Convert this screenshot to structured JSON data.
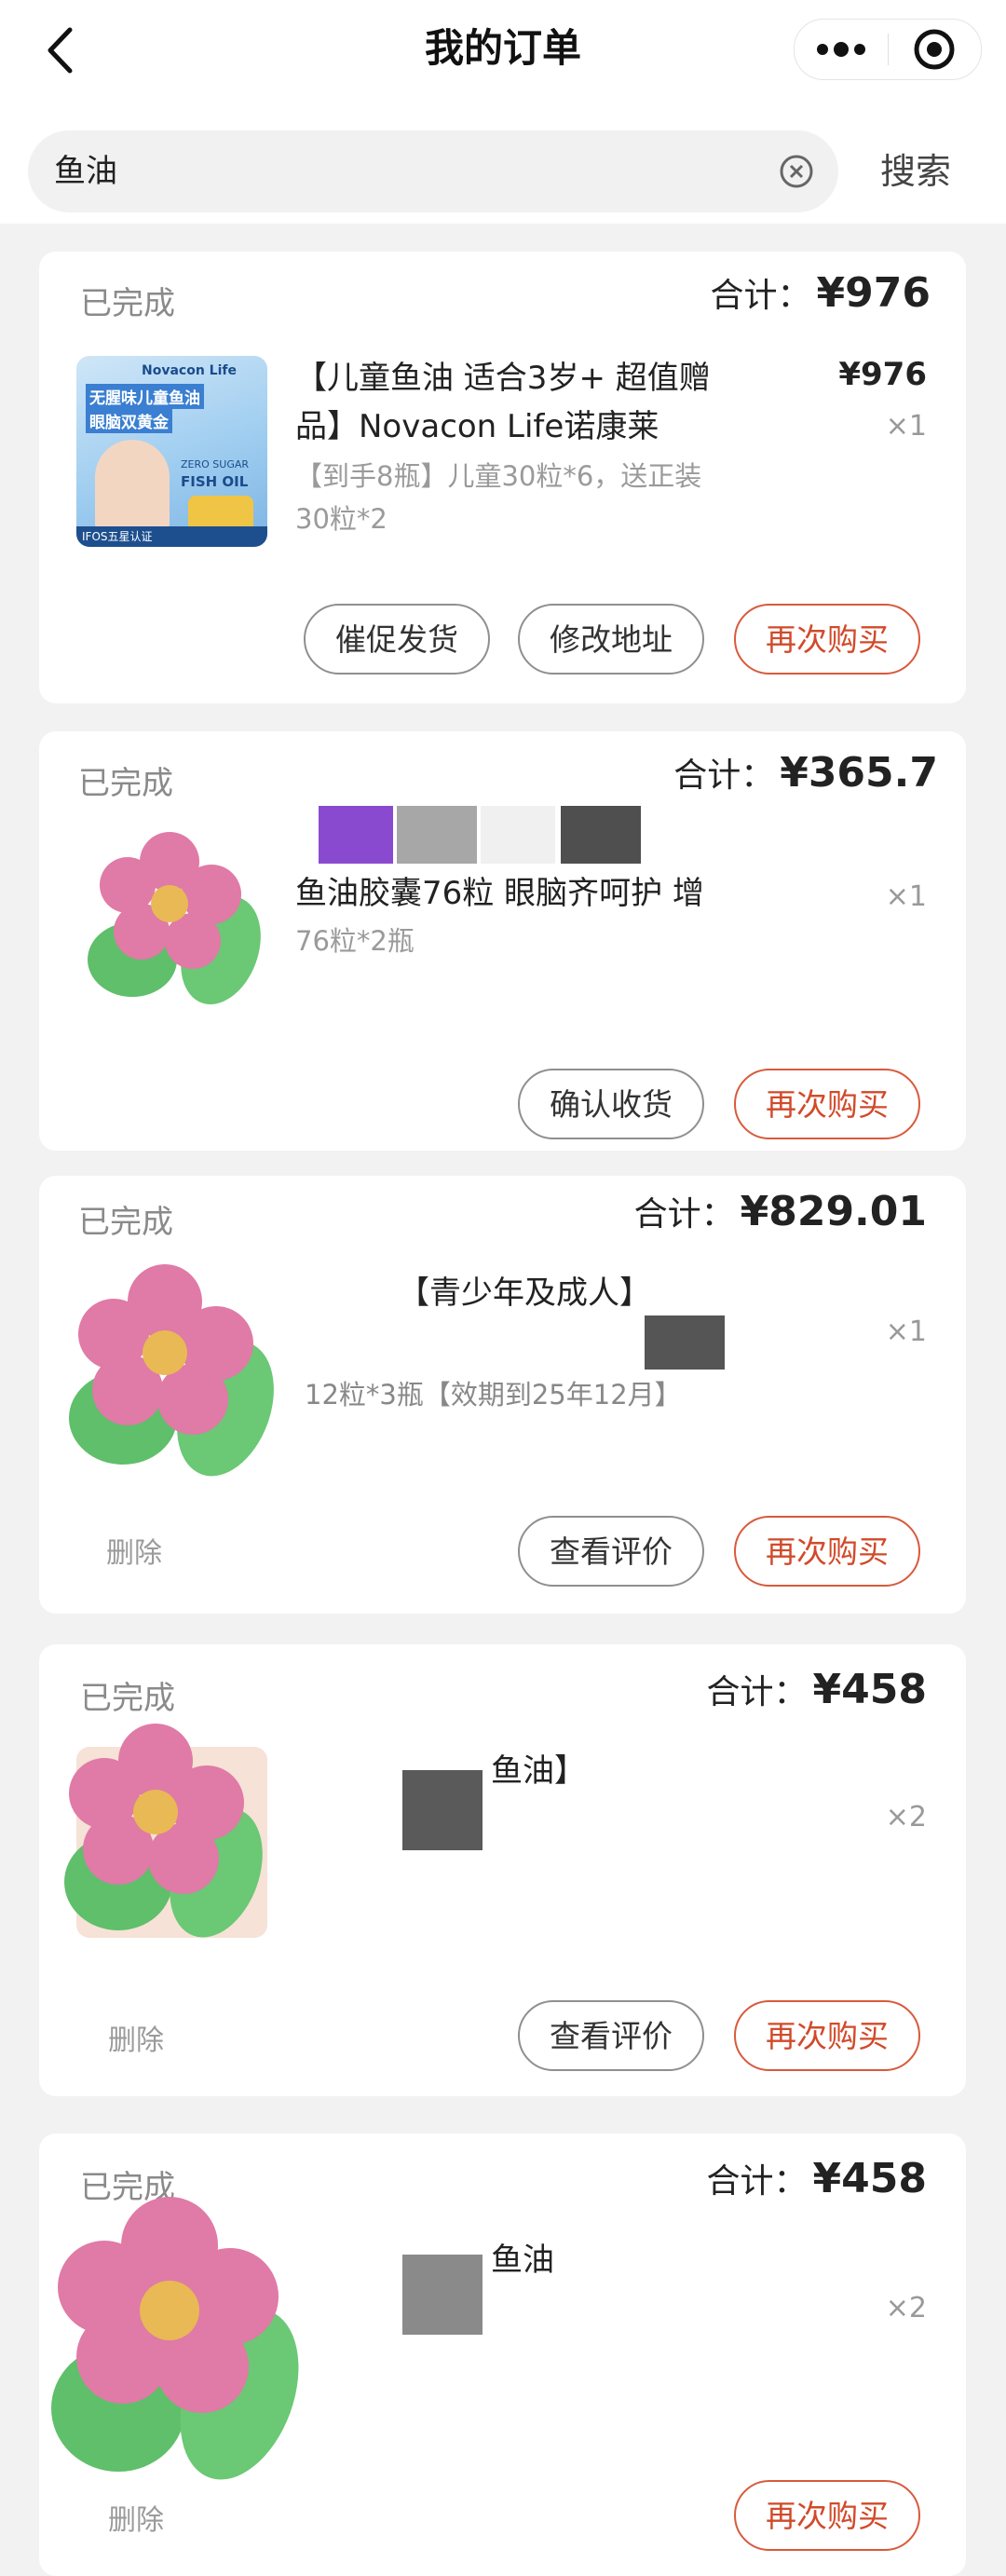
{
  "header": {
    "title": "我的订单",
    "back": "back-icon",
    "more": "more-icon",
    "target": "target-icon"
  },
  "search": {
    "value": "鱼油",
    "button": "搜索"
  },
  "orders": [
    {
      "status": "已完成",
      "total_label": "合计：",
      "total": "¥976",
      "title": "【儿童鱼油 适合3岁+ 超值赠品】Novacon Life诺康莱",
      "spec": "【到手8瓶】儿童30粒*6，送正装30粒*2",
      "unit_price": "¥976",
      "qty": "×1",
      "thumb_text": {
        "brand": "Novacon Life",
        "line1": "无腥味儿童鱼油",
        "line2": "眼脑双黄金",
        "fish": "FISH OIL",
        "cert": "IFOS五星认证",
        "zero": "ZERO SUGAR"
      },
      "buttons": [
        "催促发货",
        "修改地址",
        "再次购买"
      ]
    },
    {
      "status": "已完成",
      "total_label": "合计：",
      "total": "¥365.7",
      "title": "鱼油胶囊76粒 眼脑齐呵护 增",
      "spec": "76粒*2瓶",
      "qty": "×1",
      "buttons": [
        "确认收货",
        "再次购买"
      ]
    },
    {
      "status": "已完成",
      "total_label": "合计：",
      "total": "¥829.01",
      "title": "【青少年及成人】",
      "spec": "12粒*3瓶【效期到25年12月】",
      "qty": "×1",
      "delete": "删除",
      "buttons": [
        "查看评价",
        "再次购买"
      ]
    },
    {
      "status": "已完成",
      "total_label": "合计：",
      "total": "¥458",
      "title": "鱼油】",
      "qty": "×2",
      "delete": "删除",
      "buttons": [
        "查看评价",
        "再次购买"
      ]
    },
    {
      "status": "已完成",
      "total_label": "合计：",
      "total": "¥458",
      "title": "鱼油",
      "qty": "×2",
      "delete": "删除",
      "buttons": [
        "再次购买"
      ]
    }
  ],
  "colors": {
    "accent": "#d14a2a",
    "flower_petal": "#e07aa6",
    "flower_center": "#e9b955",
    "leaf": "#5fbf6a"
  }
}
